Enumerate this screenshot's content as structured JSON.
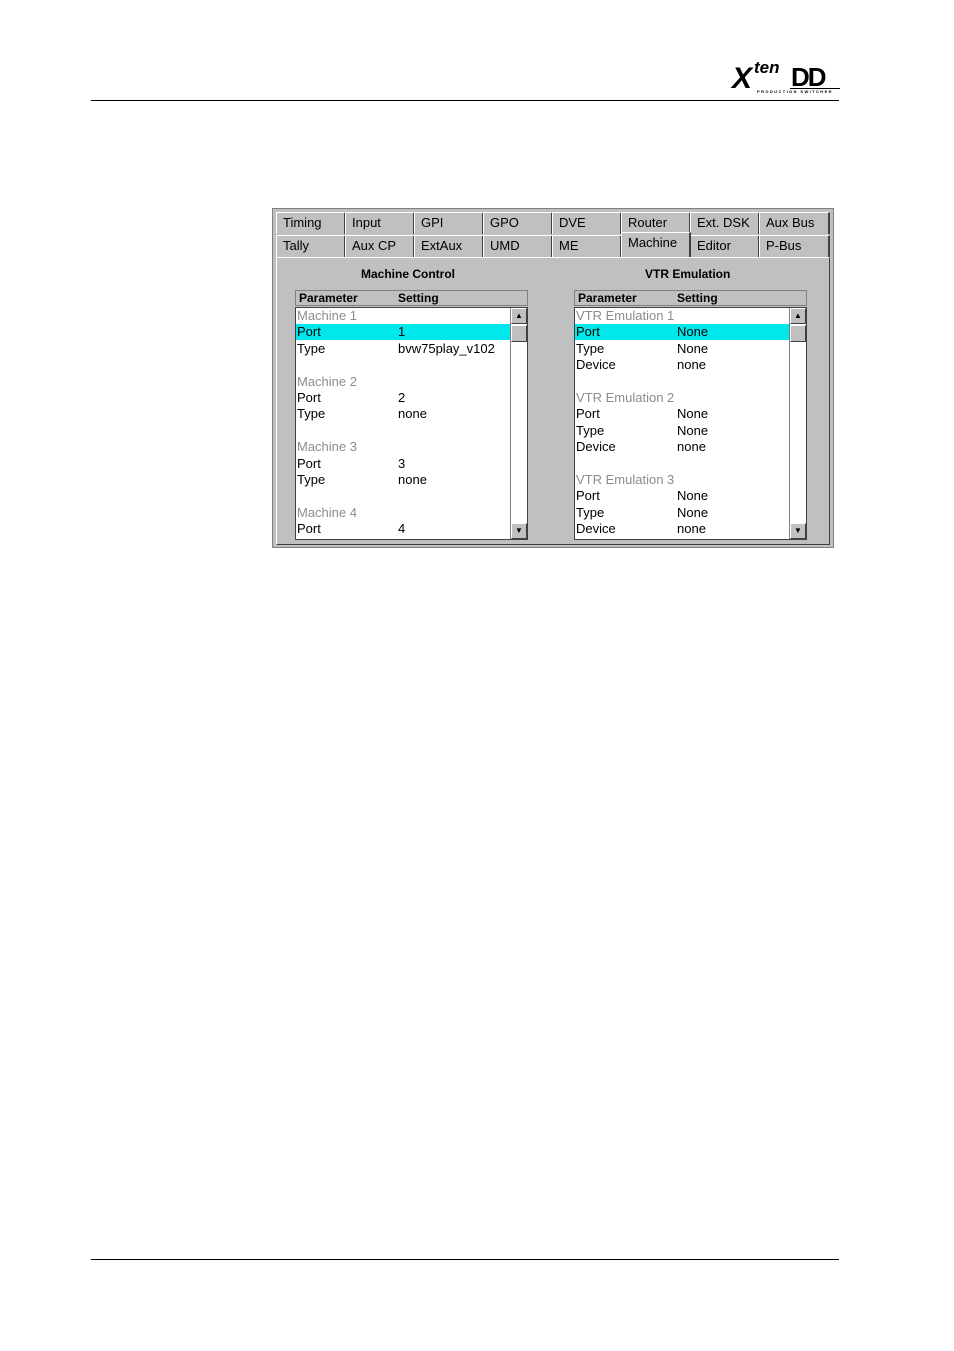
{
  "logo": {
    "main": "X",
    "sup": "ten",
    "brand": "DD",
    "tagline": "PRODUCTION SWITCHER"
  },
  "tabs_row1": [
    "Timing",
    "Input",
    "GPI",
    "GPO",
    "DVE",
    "Router",
    "Ext. DSK",
    "Aux Bus"
  ],
  "tabs_row2": [
    "Tally",
    "Aux CP",
    "ExtAux",
    "UMD",
    "ME",
    "Machine",
    "Editor",
    "P-Bus"
  ],
  "active_tab": "Machine",
  "machine_control": {
    "title": "Machine Control",
    "col_param": "Parameter",
    "col_setting": "Setting",
    "rows": [
      {
        "p": "Machine 1",
        "s": "",
        "group": true
      },
      {
        "p": "Port",
        "s": "1",
        "selected": true
      },
      {
        "p": "Type",
        "s": "bvw75play_v102"
      },
      {
        "p": "",
        "s": ""
      },
      {
        "p": "Machine 2",
        "s": "",
        "group": true
      },
      {
        "p": "Port",
        "s": "2"
      },
      {
        "p": "Type",
        "s": "none"
      },
      {
        "p": "",
        "s": ""
      },
      {
        "p": "Machine 3",
        "s": "",
        "group": true
      },
      {
        "p": "Port",
        "s": "3"
      },
      {
        "p": "Type",
        "s": "none"
      },
      {
        "p": "",
        "s": ""
      },
      {
        "p": "Machine 4",
        "s": "",
        "group": true
      },
      {
        "p": "Port",
        "s": "4"
      }
    ]
  },
  "vtr_emulation": {
    "title": "VTR Emulation",
    "col_param": "Parameter",
    "col_setting": "Setting",
    "rows": [
      {
        "p": "VTR Emulation 1",
        "s": "",
        "group": true
      },
      {
        "p": "Port",
        "s": "None",
        "selected": true
      },
      {
        "p": "Type",
        "s": "None"
      },
      {
        "p": "Device",
        "s": "none"
      },
      {
        "p": "",
        "s": ""
      },
      {
        "p": "VTR Emulation 2",
        "s": "",
        "group": true
      },
      {
        "p": "Port",
        "s": "None"
      },
      {
        "p": "Type",
        "s": "None"
      },
      {
        "p": "Device",
        "s": "none"
      },
      {
        "p": "",
        "s": ""
      },
      {
        "p": "VTR Emulation 3",
        "s": "",
        "group": true
      },
      {
        "p": "Port",
        "s": "None"
      },
      {
        "p": "Type",
        "s": "None"
      },
      {
        "p": "Device",
        "s": "none"
      }
    ]
  },
  "scroll_icons": {
    "up": "arrow-up-icon",
    "down": "arrow-down-icon"
  },
  "colors": {
    "selection": "#00e8ec",
    "group_text": "#8c8c8c",
    "dialog_bg": "#c0c0c0"
  }
}
